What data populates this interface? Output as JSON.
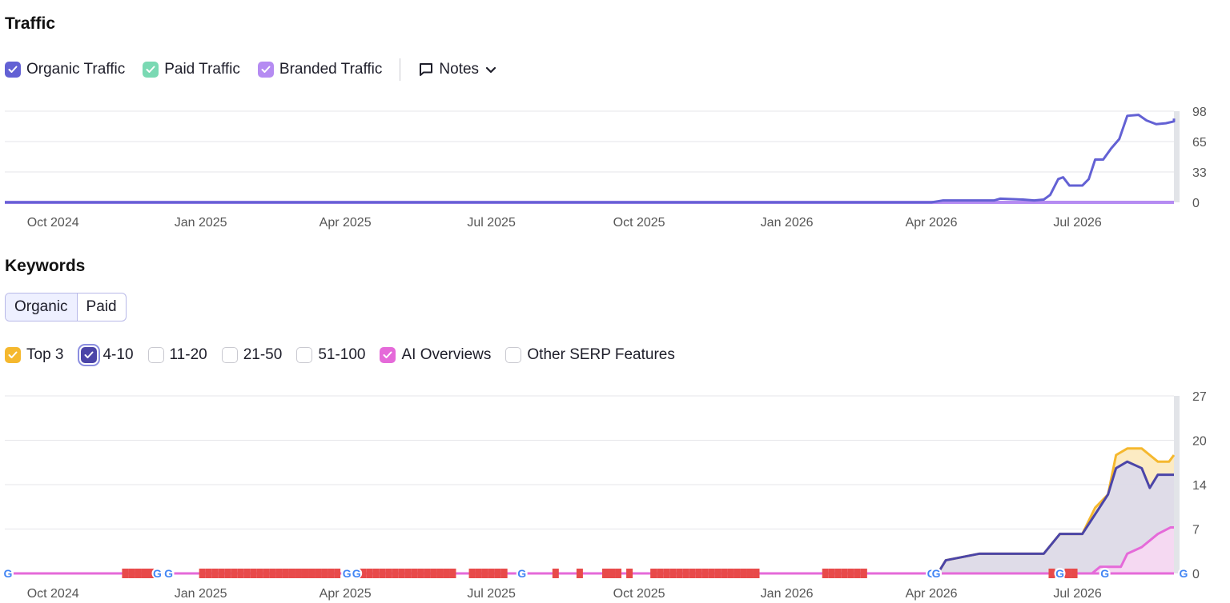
{
  "traffic": {
    "title": "Traffic",
    "legend": [
      {
        "label": "Organic Traffic",
        "checked": true,
        "color": "#6361d4"
      },
      {
        "label": "Paid Traffic",
        "checked": true,
        "color": "#7ad9b3"
      },
      {
        "label": "Branded Traffic",
        "checked": true,
        "color": "#b58bf2"
      }
    ],
    "notes_label": "Notes"
  },
  "keywords": {
    "title": "Keywords",
    "tabs": [
      {
        "label": "Organic",
        "active": true
      },
      {
        "label": "Paid",
        "active": false
      }
    ],
    "legend": [
      {
        "label": "Top 3",
        "checked": true,
        "color": "#f5b82e"
      },
      {
        "label": "4-10",
        "checked": true,
        "color": "#4b45a8"
      },
      {
        "label": "11-20",
        "checked": false
      },
      {
        "label": "21-50",
        "checked": false
      },
      {
        "label": "51-100",
        "checked": false
      },
      {
        "label": "AI Overviews",
        "checked": true,
        "color": "#e56ad9"
      },
      {
        "label": "Other SERP Features",
        "checked": false
      }
    ]
  },
  "chart_data": [
    {
      "type": "line",
      "x_ticks": [
        "Oct 2024",
        "Jan 2025",
        "Apr 2025",
        "Jul 2025",
        "Oct 2025",
        "Jan 2026",
        "Apr 2026",
        "Jul 2026"
      ],
      "y_ticks": [
        "98",
        "65",
        "33",
        "0"
      ],
      "ylim": [
        0,
        98
      ],
      "x_range": [
        "2024-09-01",
        "2026-09-20"
      ],
      "grid": true,
      "series": [
        {
          "name": "Organic Traffic",
          "color": "#6361d4",
          "points": [
            [
              "2024-09-01",
              0
            ],
            [
              "2026-04-01",
              0
            ],
            [
              "2026-04-08",
              2
            ],
            [
              "2026-05-10",
              2
            ],
            [
              "2026-05-14",
              4
            ],
            [
              "2026-05-28",
              3
            ],
            [
              "2026-06-04",
              2
            ],
            [
              "2026-06-10",
              3
            ],
            [
              "2026-06-14",
              8
            ],
            [
              "2026-06-19",
              25
            ],
            [
              "2026-06-22",
              27
            ],
            [
              "2026-06-26",
              18
            ],
            [
              "2026-07-04",
              18
            ],
            [
              "2026-07-08",
              25
            ],
            [
              "2026-07-12",
              46
            ],
            [
              "2026-07-17",
              46
            ],
            [
              "2026-07-22",
              58
            ],
            [
              "2026-07-27",
              68
            ],
            [
              "2026-08-01",
              93
            ],
            [
              "2026-08-08",
              94
            ],
            [
              "2026-08-13",
              88
            ],
            [
              "2026-08-19",
              84
            ],
            [
              "2026-08-25",
              85
            ],
            [
              "2026-08-31",
              87
            ],
            [
              "2026-09-05",
              90
            ],
            [
              "2026-09-12",
              90
            ]
          ]
        },
        {
          "name": "Branded Traffic",
          "color": "#b58bf2",
          "points": [
            [
              "2024-09-01",
              0
            ],
            [
              "2026-09-12",
              0
            ]
          ]
        }
      ]
    },
    {
      "type": "area",
      "x_ticks": [
        "Oct 2024",
        "Jan 2025",
        "Apr 2025",
        "Jul 2025",
        "Oct 2025",
        "Jan 2026",
        "Apr 2026",
        "Jul 2026"
      ],
      "y_ticks": [
        "27",
        "20",
        "14",
        "7",
        "0"
      ],
      "ylim": [
        0,
        27
      ],
      "x_range": [
        "2024-09-01",
        "2026-09-20"
      ],
      "grid": true,
      "series": [
        {
          "name": "Top 3",
          "color": "#f5b82e",
          "points": [
            [
              "2024-09-01",
              0
            ],
            [
              "2026-04-05",
              0
            ],
            [
              "2026-04-10",
              2
            ],
            [
              "2026-05-01",
              3
            ],
            [
              "2026-06-10",
              3
            ],
            [
              "2026-06-20",
              6
            ],
            [
              "2026-07-04",
              6
            ],
            [
              "2026-07-12",
              10
            ],
            [
              "2026-07-20",
              12
            ],
            [
              "2026-07-25",
              18
            ],
            [
              "2026-08-01",
              19
            ],
            [
              "2026-08-10",
              19
            ],
            [
              "2026-08-15",
              18
            ],
            [
              "2026-08-20",
              17
            ],
            [
              "2026-08-27",
              17
            ],
            [
              "2026-09-01",
              18
            ],
            [
              "2026-09-12",
              18
            ]
          ]
        },
        {
          "name": "4-10",
          "color": "#4b45a8",
          "points": [
            [
              "2024-09-01",
              0
            ],
            [
              "2026-04-05",
              0
            ],
            [
              "2026-04-10",
              2
            ],
            [
              "2026-05-01",
              3
            ],
            [
              "2026-06-10",
              3
            ],
            [
              "2026-06-20",
              6
            ],
            [
              "2026-07-04",
              6
            ],
            [
              "2026-07-12",
              9
            ],
            [
              "2026-07-20",
              12
            ],
            [
              "2026-07-25",
              16
            ],
            [
              "2026-08-01",
              17
            ],
            [
              "2026-08-10",
              16
            ],
            [
              "2026-08-15",
              13
            ],
            [
              "2026-08-20",
              15
            ],
            [
              "2026-09-12",
              15
            ]
          ]
        },
        {
          "name": "AI Overviews",
          "color": "#e56ad9",
          "points": [
            [
              "2024-09-01",
              0
            ],
            [
              "2026-07-10",
              0
            ],
            [
              "2026-07-15",
              1
            ],
            [
              "2026-07-28",
              1
            ],
            [
              "2026-08-01",
              3
            ],
            [
              "2026-08-10",
              4
            ],
            [
              "2026-08-20",
              6
            ],
            [
              "2026-08-28",
              7
            ],
            [
              "2026-09-12",
              7
            ]
          ]
        }
      ],
      "markers": {
        "google_dates": [
          "2024-09-01",
          "2024-12-05",
          "2024-12-12",
          "2025-04-02",
          "2025-04-08",
          "2025-07-20",
          "2026-04-01",
          "2026-04-04",
          "2026-06-20",
          "2026-07-18",
          "2026-09-05"
        ],
        "flag_dates": [
          "2024-11-15",
          "2024-11-19",
          "2024-11-23",
          "2024-11-27",
          "2024-12-01",
          "2024-11-30",
          "2025-01-02",
          "2025-01-06",
          "2025-01-10",
          "2025-01-14",
          "2025-01-18",
          "2025-01-22",
          "2025-01-26",
          "2025-01-30",
          "2025-02-03",
          "2025-02-07",
          "2025-02-11",
          "2025-02-15",
          "2025-02-19",
          "2025-02-23",
          "2025-02-27",
          "2025-03-03",
          "2025-03-07",
          "2025-03-11",
          "2025-03-15",
          "2025-03-19",
          "2025-03-23",
          "2025-03-27",
          "2025-04-12",
          "2025-04-16",
          "2025-04-20",
          "2025-04-24",
          "2025-04-28",
          "2025-05-02",
          "2025-05-06",
          "2025-05-10",
          "2025-05-14",
          "2025-05-18",
          "2025-05-22",
          "2025-05-26",
          "2025-05-30",
          "2025-06-03",
          "2025-06-07",
          "2025-06-19",
          "2025-06-23",
          "2025-06-27",
          "2025-07-01",
          "2025-07-05",
          "2025-07-09",
          "2025-08-10",
          "2025-08-25",
          "2025-09-10",
          "2025-09-14",
          "2025-09-18",
          "2025-09-25",
          "2025-10-10",
          "2025-10-14",
          "2025-10-18",
          "2025-10-22",
          "2025-10-26",
          "2025-10-30",
          "2025-11-03",
          "2025-11-07",
          "2025-11-11",
          "2025-11-15",
          "2025-11-19",
          "2025-11-23",
          "2025-11-27",
          "2025-12-01",
          "2025-12-05",
          "2025-12-09",
          "2025-12-13",
          "2026-01-25",
          "2026-01-29",
          "2026-02-02",
          "2026-02-06",
          "2026-02-10",
          "2026-02-14",
          "2026-02-18",
          "2026-06-15",
          "2026-06-25",
          "2026-06-29"
        ]
      }
    }
  ]
}
